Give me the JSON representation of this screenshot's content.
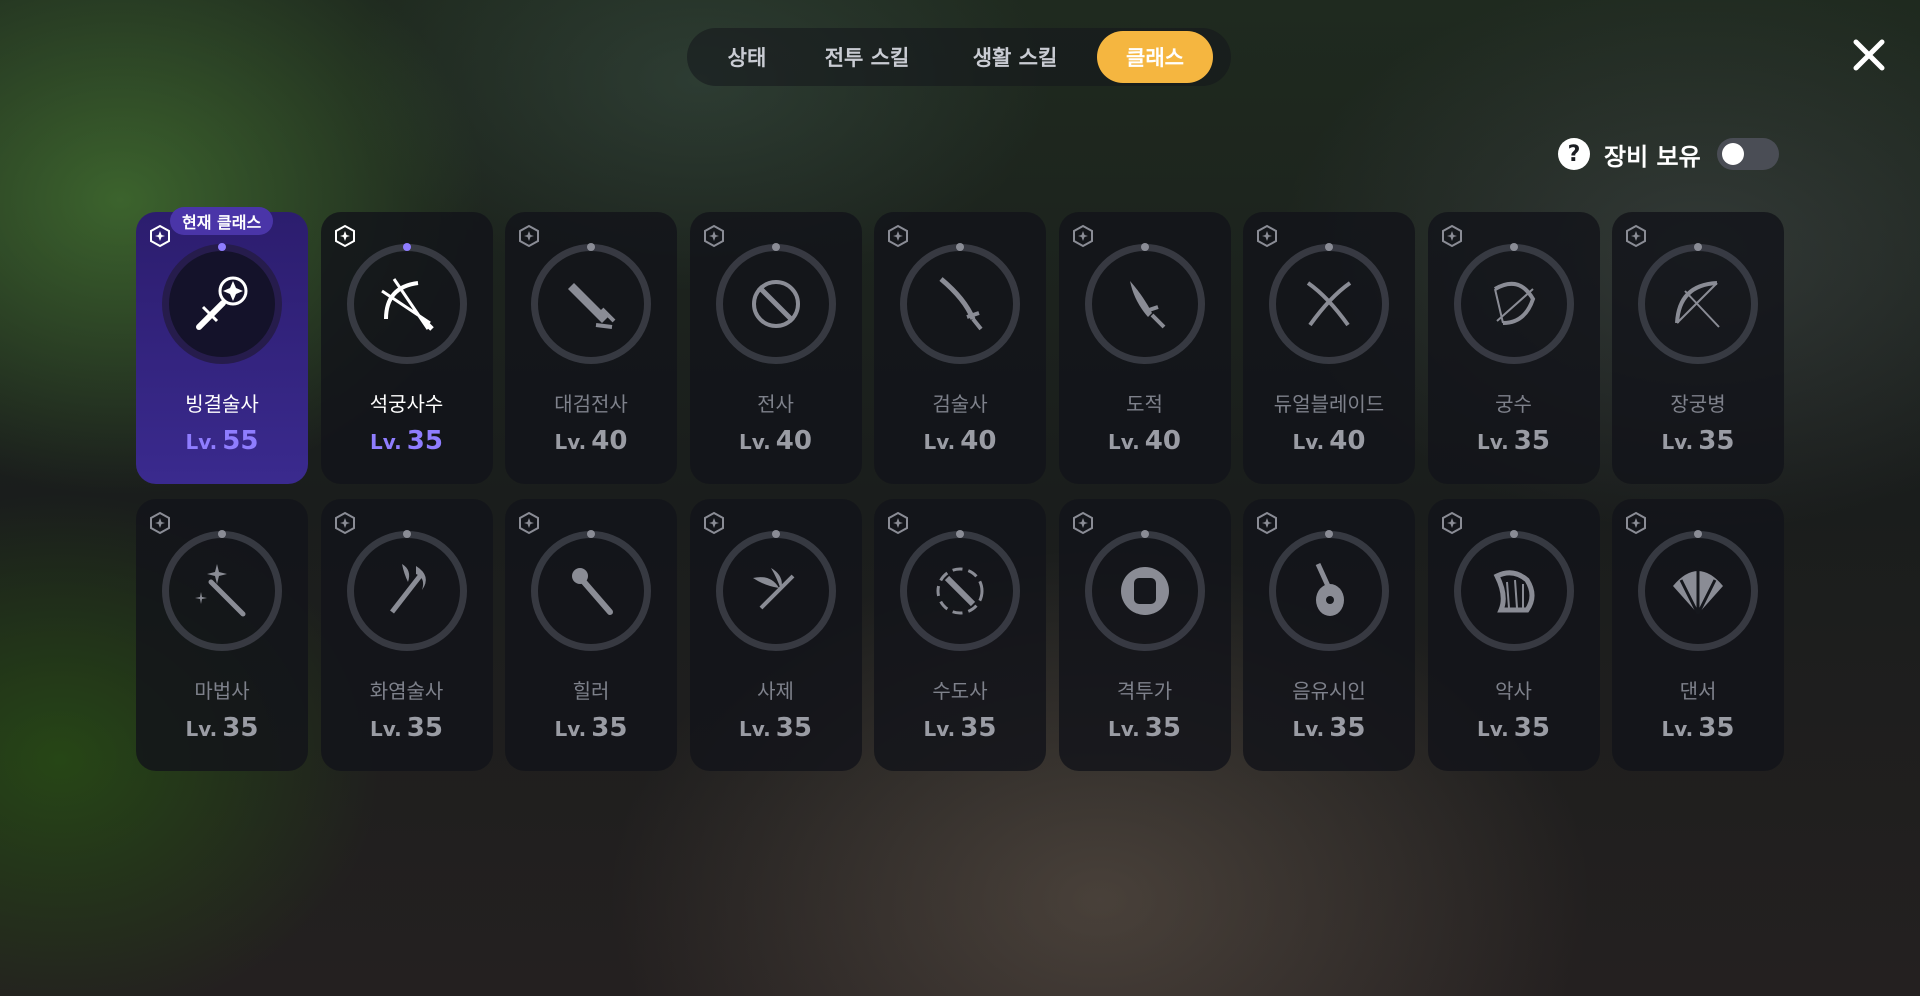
{
  "tabs": [
    {
      "label": "상태",
      "active": false
    },
    {
      "label": "전투 스킬",
      "active": false
    },
    {
      "label": "생활 스킬",
      "active": false
    },
    {
      "label": "클래스",
      "active": true
    }
  ],
  "equip_filter": {
    "label": "장비 보유",
    "enabled": false,
    "help_icon": "question-icon"
  },
  "current_class_badge": "현재 클래스",
  "level_prefix": "Lv.",
  "colors": {
    "accent": "#f5b640",
    "level_highlight": "#8f7dff",
    "current_card": "#3a2a8e"
  },
  "classes": [
    {
      "name": "빙결술사",
      "level": "55",
      "icon": "ice-staff-icon",
      "state": "current"
    },
    {
      "name": "석궁사수",
      "level": "35",
      "icon": "crossbow-icon",
      "state": "unlocked"
    },
    {
      "name": "대검전사",
      "level": "40",
      "icon": "greatsword-icon",
      "state": "locked"
    },
    {
      "name": "전사",
      "level": "40",
      "icon": "sword-shield-icon",
      "state": "locked"
    },
    {
      "name": "검술사",
      "level": "40",
      "icon": "katana-icon",
      "state": "locked"
    },
    {
      "name": "도적",
      "level": "40",
      "icon": "dagger-icon",
      "state": "locked"
    },
    {
      "name": "듀얼블레이드",
      "level": "40",
      "icon": "dual-blades-icon",
      "state": "locked"
    },
    {
      "name": "궁수",
      "level": "35",
      "icon": "bow-icon",
      "state": "locked"
    },
    {
      "name": "장궁병",
      "level": "35",
      "icon": "longbow-icon",
      "state": "locked"
    },
    {
      "name": "마법사",
      "level": "35",
      "icon": "wand-icon",
      "state": "locked"
    },
    {
      "name": "화염술사",
      "level": "35",
      "icon": "fire-staff-icon",
      "state": "locked"
    },
    {
      "name": "힐러",
      "level": "35",
      "icon": "healing-staff-icon",
      "state": "locked"
    },
    {
      "name": "사제",
      "level": "35",
      "icon": "winged-staff-icon",
      "state": "locked"
    },
    {
      "name": "수도사",
      "level": "35",
      "icon": "monk-icon",
      "state": "locked"
    },
    {
      "name": "격투가",
      "level": "35",
      "icon": "fist-icon",
      "state": "locked"
    },
    {
      "name": "음유시인",
      "level": "35",
      "icon": "lute-icon",
      "state": "locked"
    },
    {
      "name": "악사",
      "level": "35",
      "icon": "harp-icon",
      "state": "locked"
    },
    {
      "name": "댄서",
      "level": "35",
      "icon": "fan-icon",
      "state": "locked"
    }
  ]
}
